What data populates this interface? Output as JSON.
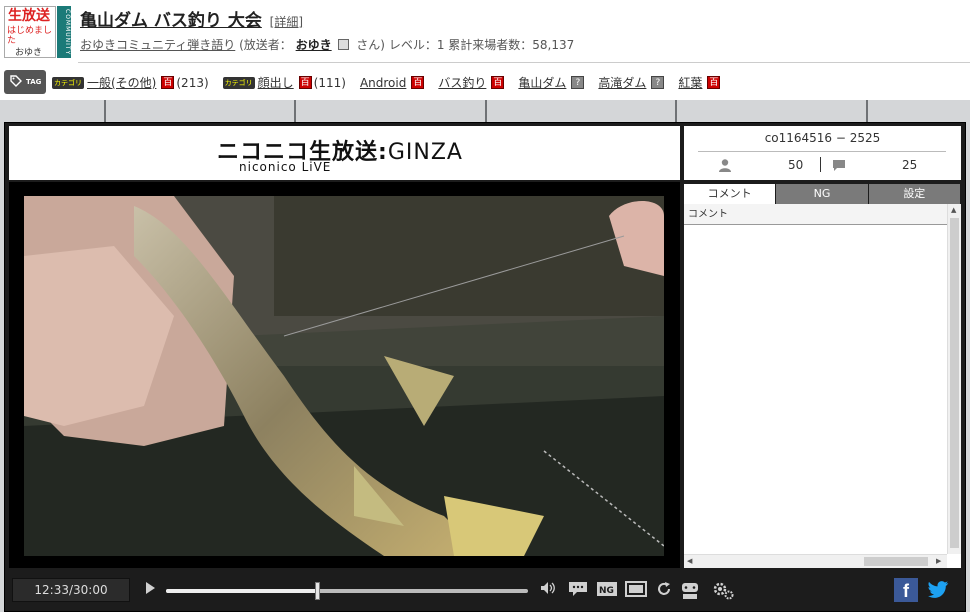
{
  "header": {
    "thumb_line1": "生放送",
    "thumb_line2": "はじめました",
    "thumb_line3": "おゆき",
    "community_strip": "COMMUNITY",
    "title": "亀山ダム バス釣り 大会",
    "detail_link": "[詳細]",
    "community_name": "おゆきコミュニティ弾き語り",
    "broadcaster_prefix": "(放送者：",
    "broadcaster": "おゆき",
    "broadcaster_suffix": "さん)",
    "level_text": "レベル：1",
    "visitors_text": "累計来場者数：58,137"
  },
  "tags": {
    "badge": "TAG",
    "items": [
      {
        "category": "カテゴリ",
        "label": "一般(その他)",
        "count": "(213)",
        "ency": "red"
      },
      {
        "category": "カテゴリ",
        "label": "顔出し",
        "count": "(111)",
        "ency": "red"
      },
      {
        "category": "",
        "label": "Android",
        "count": "",
        "ency": "red"
      },
      {
        "category": "",
        "label": "バス釣り",
        "count": "",
        "ency": "red"
      },
      {
        "category": "",
        "label": "亀山ダム",
        "count": "",
        "ency": "gray"
      },
      {
        "category": "",
        "label": "高滝ダム",
        "count": "",
        "ency": "gray"
      },
      {
        "category": "",
        "label": "紅葉",
        "count": "",
        "ency": "red"
      }
    ],
    "ency_glyph": "百",
    "ency_glyph_gray": "?"
  },
  "player": {
    "logo_main": "ニコニコ生放送",
    "logo_colon": ":",
    "logo_ginza": "GINZA",
    "logo_sub": "niconico LiVE"
  },
  "side": {
    "stream_id": "co1164516 − 2525",
    "viewers": "50",
    "comments": "25",
    "tabs": [
      "コメント",
      "NG",
      "設定"
    ],
    "comment_header": "コメント"
  },
  "controls": {
    "time": "12:33/30:00",
    "progress": 0.418,
    "fb_label": "f"
  },
  "colors": {
    "accent_red": "#cc0000",
    "facebook": "#3b5998",
    "twitter": "#1da1f2"
  },
  "icons": [
    "tag-icon",
    "user-icon",
    "comment-icon",
    "play-icon",
    "volume-icon",
    "comment-toggle-icon",
    "ng-icon",
    "screen-icon",
    "reload-icon",
    "app-icon",
    "settings-icon",
    "facebook-icon",
    "twitter-icon"
  ]
}
